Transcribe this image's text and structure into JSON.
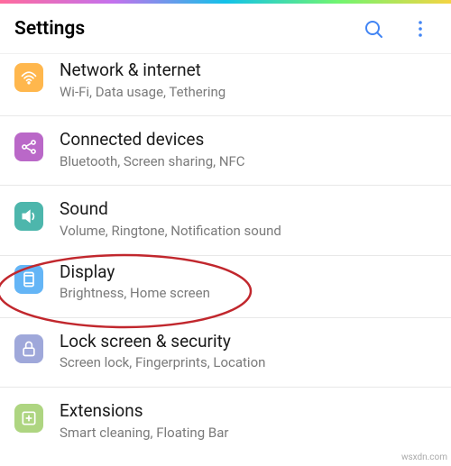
{
  "header": {
    "title": "Settings"
  },
  "items": [
    {
      "title": "Network & internet",
      "desc": "Wi-Fi, Data usage, Tethering"
    },
    {
      "title": "Connected devices",
      "desc": "Bluetooth, Screen sharing, NFC"
    },
    {
      "title": "Sound",
      "desc": "Volume, Ringtone, Notification sound"
    },
    {
      "title": "Display",
      "desc": "Brightness, Home screen"
    },
    {
      "title": "Lock screen & security",
      "desc": "Screen lock, Fingerprints, Location"
    },
    {
      "title": "Extensions",
      "desc": "Smart cleaning, Floating Bar"
    }
  ],
  "watermark": "wsxdn.com"
}
